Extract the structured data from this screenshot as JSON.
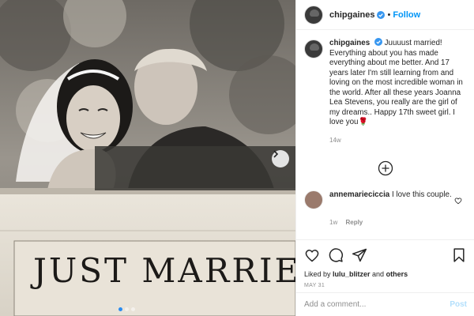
{
  "photo": {
    "sign_text": "JUST MARRIE",
    "dots": 3,
    "active_dot": 0
  },
  "header": {
    "username": "chipgaines",
    "separator": "•",
    "follow_label": "Follow"
  },
  "caption": {
    "username": "chipgaines",
    "text": " Juuuust married! Everything about you has made everything about me better. And 17 years later I'm still learning from and loving on the most incredible woman in the world. After all these years Joanna Lea Stevens, you really are the girl of my dreams.. Happy 17th sweet girl. I love you",
    "emoji": "🌹",
    "time": "14w"
  },
  "comment": {
    "username": "annemarieciccia",
    "text": " I love this couple.",
    "time": "1w",
    "reply_label": "Reply"
  },
  "likes": {
    "prefix": "Liked by ",
    "user": "lulu_blitzer",
    "suffix": " and ",
    "others": "others"
  },
  "post_date": "MAY 31",
  "add_comment": {
    "placeholder": "Add a comment...",
    "post_label": "Post"
  },
  "colors": {
    "accent": "#0095f6",
    "verified": "#3897f0",
    "post_disabled": "#b2dffc"
  },
  "icons": [
    "verified-badge-icon",
    "chevron-right-icon",
    "plus-circle-icon",
    "heart-icon",
    "comment-icon",
    "share-icon",
    "bookmark-icon"
  ]
}
